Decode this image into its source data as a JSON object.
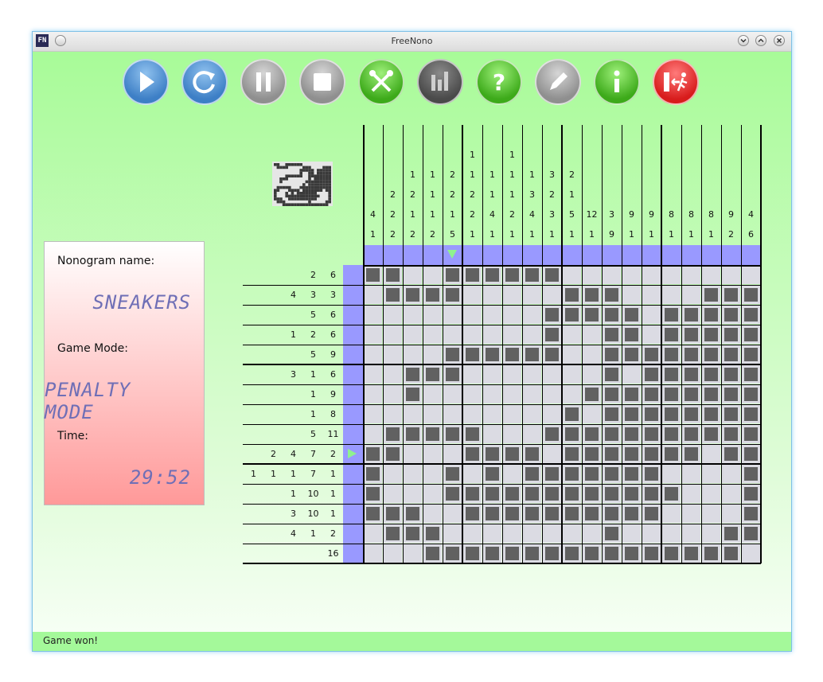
{
  "window": {
    "title": "FreeNono",
    "app_icon": "FN"
  },
  "toolbar": [
    {
      "name": "start-button",
      "icon": "play-icon"
    },
    {
      "name": "restart-button",
      "icon": "restart-icon"
    },
    {
      "name": "pause-button",
      "icon": "pause-icon"
    },
    {
      "name": "stop-button",
      "icon": "stop-icon"
    },
    {
      "name": "settings-button",
      "icon": "tools-icon"
    },
    {
      "name": "statistics-button",
      "icon": "bar-chart-icon"
    },
    {
      "name": "help-button",
      "icon": "question-icon"
    },
    {
      "name": "editor-button",
      "icon": "pencil-icon"
    },
    {
      "name": "about-button",
      "icon": "info-icon"
    },
    {
      "name": "exit-button",
      "icon": "exit-icon"
    }
  ],
  "info": {
    "name_label": "Nonogram name:",
    "name_value": "SNEAKERS",
    "mode_label": "Game Mode:",
    "mode_value": "PENALTY MODE",
    "time_label": "Time:",
    "time_value": "29:52"
  },
  "status": "Game won!",
  "puzzle": {
    "columns": [
      [
        4,
        1
      ],
      [
        2,
        2,
        2
      ],
      [
        1,
        2,
        1,
        2
      ],
      [
        1,
        1,
        1,
        2
      ],
      [
        2,
        2,
        1,
        5
      ],
      [
        1,
        1,
        2,
        2,
        1
      ],
      [
        1,
        1,
        4,
        1
      ],
      [
        1,
        1,
        1,
        2,
        1
      ],
      [
        1,
        3,
        4,
        1
      ],
      [
        3,
        2,
        3,
        1
      ],
      [
        2,
        1,
        5,
        1
      ],
      [
        12,
        1
      ],
      [
        3,
        9
      ],
      [
        9,
        1
      ],
      [
        9,
        1
      ],
      [
        8,
        1
      ],
      [
        8,
        1
      ],
      [
        8,
        1
      ],
      [
        9,
        2
      ],
      [
        4,
        6
      ]
    ],
    "rows": [
      [
        2,
        6
      ],
      [
        4,
        3,
        3
      ],
      [
        5,
        6
      ],
      [
        1,
        2,
        6
      ],
      [
        5,
        9
      ],
      [
        3,
        1,
        6
      ],
      [
        1,
        9
      ],
      [
        1,
        8
      ],
      [
        5,
        11
      ],
      [
        2,
        4,
        7,
        2
      ],
      [
        1,
        1,
        1,
        7,
        1
      ],
      [
        1,
        10,
        1
      ],
      [
        3,
        10,
        1
      ],
      [
        4,
        1,
        2
      ],
      [
        16
      ]
    ],
    "grid": [
      "11001111110000000000",
      "01111000001110000111",
      "00000000011111011111",
      "00000000010011011111",
      "00001111110011111111",
      "00111000000010111111",
      "00100000000111111111",
      "00000000001011111111",
      "01111100011111111111",
      "11000111101111111011",
      "10001010111111100001",
      "10001111111111110001",
      "11100111111111100001",
      "01110000000010000011",
      "00011111111111111110"
    ],
    "colors": {
      "filled": "#616161",
      "empty": "#dbdbe3",
      "hint_bar": "#9999ff",
      "marker": "#8ff28f"
    }
  }
}
